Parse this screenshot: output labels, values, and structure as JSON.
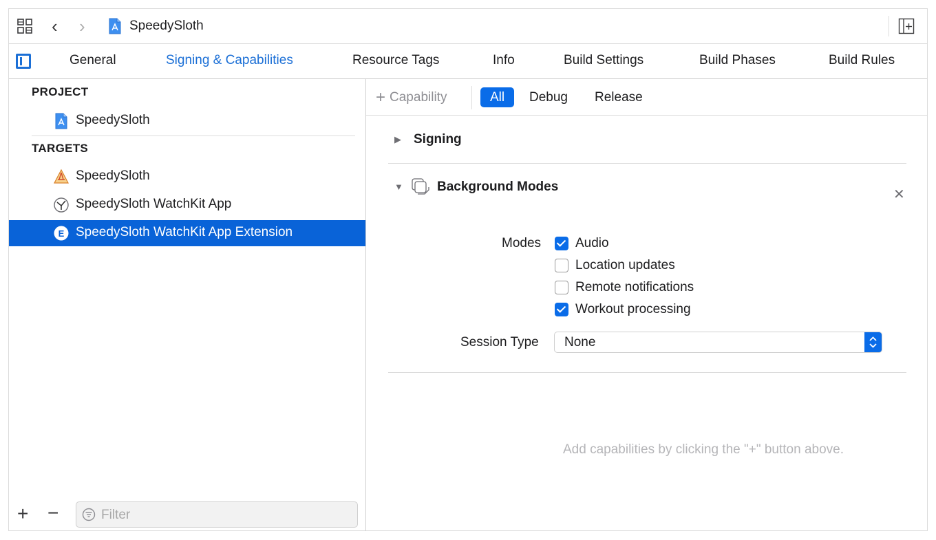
{
  "window": {
    "title": "SpeedySloth"
  },
  "tabs": [
    {
      "label": "General"
    },
    {
      "label": "Signing & Capabilities"
    },
    {
      "label": "Resource Tags"
    },
    {
      "label": "Info"
    },
    {
      "label": "Build Settings"
    },
    {
      "label": "Build Phases"
    },
    {
      "label": "Build Rules"
    }
  ],
  "active_tab": "Signing & Capabilities",
  "sidebar": {
    "project_header": "PROJECT",
    "project_item": "SpeedySloth",
    "targets_header": "TARGETS",
    "targets": [
      {
        "label": "SpeedySloth",
        "icon": "app-target-icon"
      },
      {
        "label": "SpeedySloth WatchKit App",
        "icon": "watchkit-app-icon"
      },
      {
        "label": "SpeedySloth WatchKit App Extension",
        "icon": "extension-icon"
      }
    ],
    "selected_target": "SpeedySloth WatchKit App Extension",
    "filter_placeholder": "Filter"
  },
  "capability_bar": {
    "add_label": "Capability",
    "segments": [
      "All",
      "Debug",
      "Release"
    ],
    "selected_segment": "All"
  },
  "signing": {
    "title": "Signing",
    "expanded": false
  },
  "background_modes": {
    "title": "Background Modes",
    "expanded": true,
    "modes_label": "Modes",
    "modes": [
      {
        "label": "Audio",
        "checked": true
      },
      {
        "label": "Location updates",
        "checked": false
      },
      {
        "label": "Remote notifications",
        "checked": false
      },
      {
        "label": "Workout processing",
        "checked": true
      }
    ],
    "session_type_label": "Session Type",
    "session_type_value": "None"
  },
  "hint": "Add capabilities by clicking the \"+\" button above.",
  "colors": {
    "accent": "#0a6ce8",
    "selection": "#0963d8"
  }
}
